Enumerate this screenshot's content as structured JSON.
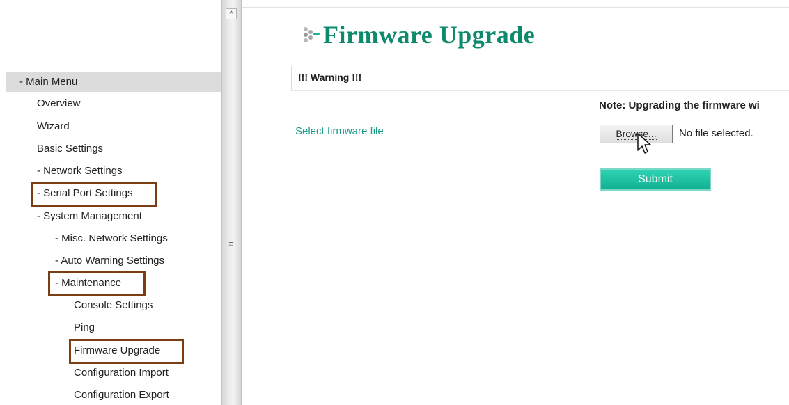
{
  "sidebar": {
    "header": "- Main Menu",
    "items": [
      {
        "label": "Overview"
      },
      {
        "label": "Wizard"
      },
      {
        "label": "Basic Settings"
      },
      {
        "label": "- Network Settings"
      },
      {
        "label": "- Serial Port Settings",
        "highlighted": true
      },
      {
        "label": "- System Management"
      },
      {
        "label": "- Misc. Network Settings"
      },
      {
        "label": "- Auto Warning Settings"
      },
      {
        "label": "- Maintenance",
        "highlighted": true
      },
      {
        "label": "Console Settings"
      },
      {
        "label": "Ping"
      },
      {
        "label": "Firmware Upgrade",
        "highlighted": true
      },
      {
        "label": "Configuration Import"
      },
      {
        "label": "Configuration Export"
      }
    ],
    "highlight_color": "#7a3d14"
  },
  "scrollbar": {
    "up_icon": "chevron-up-icon",
    "grip_icon": "grip-icon"
  },
  "main": {
    "title": "Firmware Upgrade",
    "title_color": "#0d8a6c",
    "warning": "!!! Warning !!!",
    "note": "Note: Upgrading the firmware wi",
    "select_label": "Select firmware file",
    "browse_label": "Browse...",
    "file_status": "No file selected.",
    "submit_label": "Submit",
    "accent": "#1ab596"
  }
}
